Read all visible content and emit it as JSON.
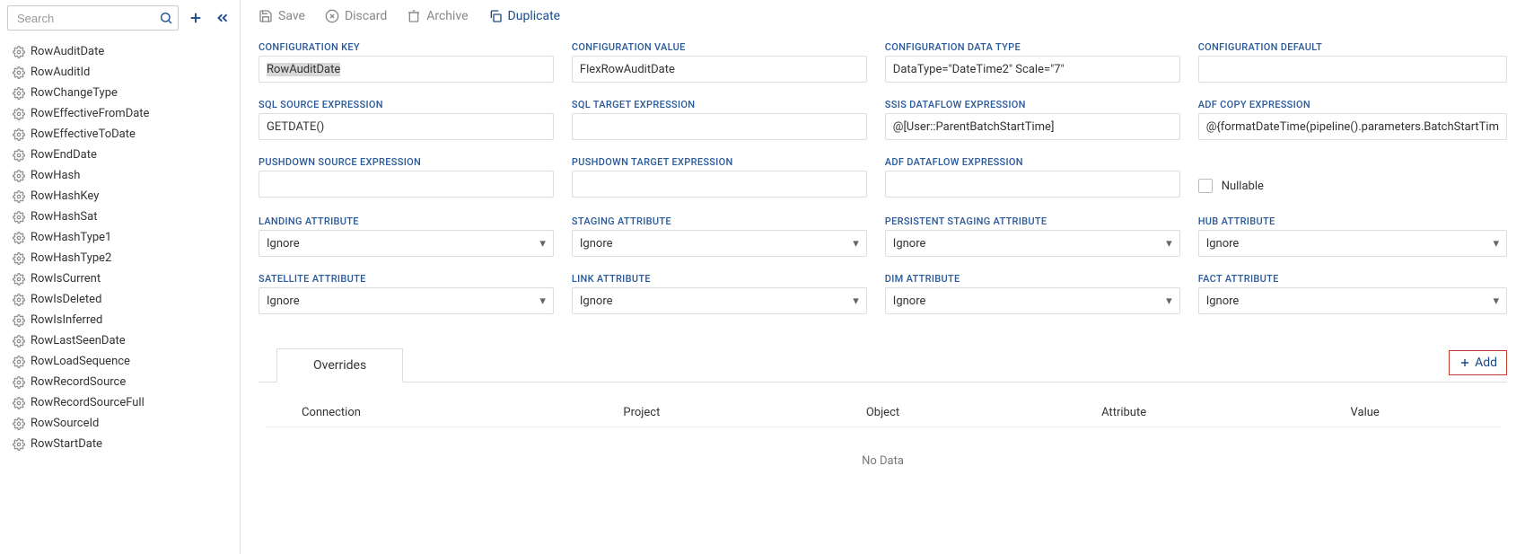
{
  "sidebar": {
    "search_placeholder": "Search",
    "items": [
      "RowAuditDate",
      "RowAuditId",
      "RowChangeType",
      "RowEffectiveFromDate",
      "RowEffectiveToDate",
      "RowEndDate",
      "RowHash",
      "RowHashKey",
      "RowHashSat",
      "RowHashType1",
      "RowHashType2",
      "RowIsCurrent",
      "RowIsDeleted",
      "RowIsInferred",
      "RowLastSeenDate",
      "RowLoadSequence",
      "RowRecordSource",
      "RowRecordSourceFull",
      "RowSourceId",
      "RowStartDate"
    ]
  },
  "toolbar": {
    "save": "Save",
    "discard": "Discard",
    "archive": "Archive",
    "duplicate": "Duplicate"
  },
  "fields": {
    "config_key": {
      "label": "CONFIGURATION KEY",
      "value": "RowAuditDate"
    },
    "config_value": {
      "label": "CONFIGURATION VALUE",
      "value": "FlexRowAuditDate"
    },
    "config_type": {
      "label": "CONFIGURATION DATA TYPE",
      "value": "DataType=\"DateTime2\" Scale=\"7\""
    },
    "config_default": {
      "label": "CONFIGURATION DEFAULT",
      "value": ""
    },
    "sql_source": {
      "label": "SQL SOURCE EXPRESSION",
      "value": "GETDATE()"
    },
    "sql_target": {
      "label": "SQL TARGET EXPRESSION",
      "value": ""
    },
    "ssis_df": {
      "label": "SSIS DATAFLOW EXPRESSION",
      "value": "@[User::ParentBatchStartTime]"
    },
    "adf_copy": {
      "label": "ADF COPY EXPRESSION",
      "value": "@{formatDateTime(pipeline().parameters.BatchStartTim"
    },
    "pushdown_src": {
      "label": "PUSHDOWN SOURCE EXPRESSION",
      "value": ""
    },
    "pushdown_tgt": {
      "label": "PUSHDOWN TARGET EXPRESSION",
      "value": ""
    },
    "adf_df": {
      "label": "ADF DATAFLOW EXPRESSION",
      "value": ""
    },
    "nullable": {
      "label": "Nullable",
      "checked": false
    },
    "landing": {
      "label": "LANDING ATTRIBUTE",
      "value": "Ignore"
    },
    "staging": {
      "label": "STAGING ATTRIBUTE",
      "value": "Ignore"
    },
    "pstaging": {
      "label": "PERSISTENT STAGING ATTRIBUTE",
      "value": "Ignore"
    },
    "hub": {
      "label": "HUB ATTRIBUTE",
      "value": "Ignore"
    },
    "satellite": {
      "label": "SATELLITE ATTRIBUTE",
      "value": "Ignore"
    },
    "link": {
      "label": "LINK ATTRIBUTE",
      "value": "Ignore"
    },
    "dim": {
      "label": "DIM ATTRIBUTE",
      "value": "Ignore"
    },
    "fact": {
      "label": "FACT ATTRIBUTE",
      "value": "Ignore"
    }
  },
  "overrides": {
    "tab": "Overrides",
    "add": "Add",
    "columns": [
      "Connection",
      "Project",
      "Object",
      "Attribute",
      "Value"
    ],
    "no_data": "No Data"
  }
}
